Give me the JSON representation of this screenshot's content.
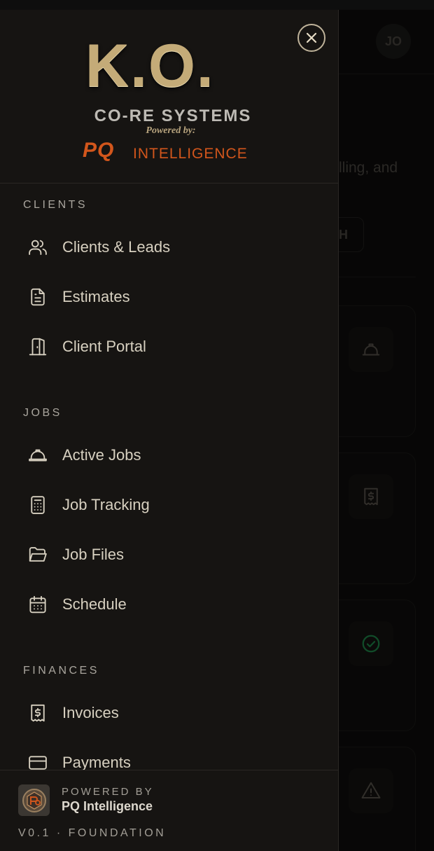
{
  "background": {
    "avatar_initials": "JO",
    "subtitle_fragment": "lling, and",
    "button_fragment": "H"
  },
  "drawer": {
    "logo": {
      "main": "K.O.",
      "subtitle": "CO-RE SYSTEMS",
      "powered_by": "Powered by:",
      "pq": "PQ",
      "intelligence": "INTELLIGENCE"
    },
    "sections": [
      {
        "title": "CLIENTS",
        "items": [
          {
            "label": "Clients & Leads",
            "icon": "users-icon"
          },
          {
            "label": "Estimates",
            "icon": "document-icon"
          },
          {
            "label": "Client Portal",
            "icon": "door-icon"
          }
        ]
      },
      {
        "title": "JOBS",
        "items": [
          {
            "label": "Active Jobs",
            "icon": "hard-hat-icon"
          },
          {
            "label": "Job Tracking",
            "icon": "calculator-icon"
          },
          {
            "label": "Job Files",
            "icon": "folder-open-icon"
          },
          {
            "label": "Schedule",
            "icon": "calendar-icon"
          }
        ]
      },
      {
        "title": "FINANCES",
        "items": [
          {
            "label": "Invoices",
            "icon": "receipt-dollar-icon"
          },
          {
            "label": "Payments",
            "icon": "credit-card-icon"
          }
        ]
      }
    ],
    "footer": {
      "powered_label": "POWERED BY",
      "brand": "PQ Intelligence",
      "version": "V0.1 · FOUNDATION"
    }
  },
  "colors": {
    "drawer_bg": "#161412",
    "accent_gold": "#c4ab78",
    "accent_orange": "#d2561c",
    "text": "#d7d0c0",
    "success_green": "#1f8a4c"
  }
}
